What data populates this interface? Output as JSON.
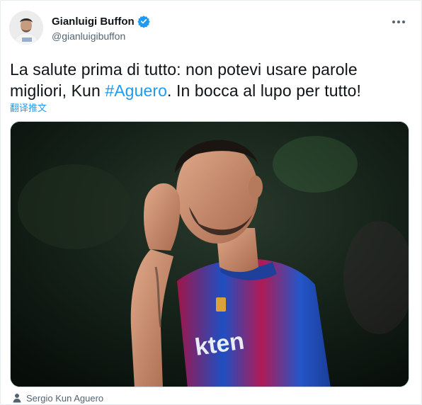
{
  "author": {
    "display_name": "Gianluigi Buffon",
    "handle": "@gianluigibuffon",
    "verified": true,
    "avatar_icon": "profile-avatar"
  },
  "tweet": {
    "text_line1": "La salute prima di tutto: non potevi usare parole",
    "text_before_hashtag": "migliori, Kun ",
    "hashtag": "#Aguero",
    "text_after_hashtag": ". In bocca al lupo per tutto!",
    "translate_label": "翻译推文"
  },
  "media": {
    "alt": "Sergio Aguero in Barcelona kit",
    "tagged_person": "Sergio Kun Aguero",
    "tag_icon": "person-icon"
  },
  "colors": {
    "accent": "#1d9bf0",
    "text_primary": "#0f1419",
    "text_secondary": "#536471"
  }
}
